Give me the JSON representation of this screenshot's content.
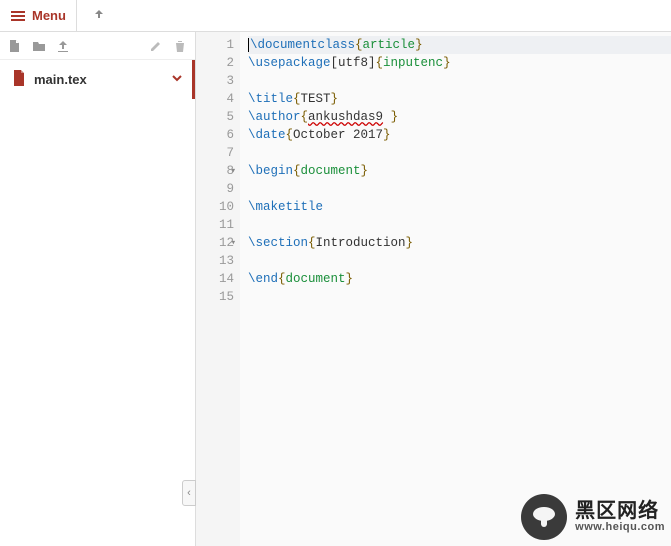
{
  "topbar": {
    "menu_label": "Menu"
  },
  "sidebar": {
    "file": {
      "name": "main.tex"
    }
  },
  "editor": {
    "lines": [
      {
        "n": 1,
        "fold": false,
        "hl": true,
        "tokens": [
          [
            "cursor",
            ""
          ],
          [
            "cmd",
            "\\documentclass"
          ],
          [
            "brace",
            "{"
          ],
          [
            "type",
            "article"
          ],
          [
            "brace",
            "}"
          ]
        ]
      },
      {
        "n": 2,
        "fold": false,
        "hl": false,
        "tokens": [
          [
            "cmd",
            "\\usepackage"
          ],
          [
            "txt",
            "[utf8]"
          ],
          [
            "brace",
            "{"
          ],
          [
            "type",
            "inputenc"
          ],
          [
            "brace",
            "}"
          ]
        ]
      },
      {
        "n": 3,
        "fold": false,
        "hl": false,
        "tokens": []
      },
      {
        "n": 4,
        "fold": false,
        "hl": false,
        "tokens": [
          [
            "cmd",
            "\\title"
          ],
          [
            "brace",
            "{"
          ],
          [
            "txt",
            "TEST"
          ],
          [
            "brace",
            "}"
          ]
        ]
      },
      {
        "n": 5,
        "fold": false,
        "hl": false,
        "tokens": [
          [
            "cmd",
            "\\author"
          ],
          [
            "brace",
            "{"
          ],
          [
            "err",
            "ankushdas9"
          ],
          [
            "txt",
            " "
          ],
          [
            "brace",
            "}"
          ]
        ]
      },
      {
        "n": 6,
        "fold": false,
        "hl": false,
        "tokens": [
          [
            "cmd",
            "\\date"
          ],
          [
            "brace",
            "{"
          ],
          [
            "txt",
            "October 2017"
          ],
          [
            "brace",
            "}"
          ]
        ]
      },
      {
        "n": 7,
        "fold": false,
        "hl": false,
        "tokens": []
      },
      {
        "n": 8,
        "fold": true,
        "hl": false,
        "tokens": [
          [
            "cmd",
            "\\begin"
          ],
          [
            "brace",
            "{"
          ],
          [
            "type",
            "document"
          ],
          [
            "brace",
            "}"
          ]
        ]
      },
      {
        "n": 9,
        "fold": false,
        "hl": false,
        "tokens": []
      },
      {
        "n": 10,
        "fold": false,
        "hl": false,
        "tokens": [
          [
            "cmd",
            "\\maketitle"
          ]
        ]
      },
      {
        "n": 11,
        "fold": false,
        "hl": false,
        "tokens": []
      },
      {
        "n": 12,
        "fold": true,
        "hl": false,
        "tokens": [
          [
            "cmd",
            "\\section"
          ],
          [
            "brace",
            "{"
          ],
          [
            "txt",
            "Introduction"
          ],
          [
            "brace",
            "}"
          ]
        ]
      },
      {
        "n": 13,
        "fold": false,
        "hl": false,
        "tokens": []
      },
      {
        "n": 14,
        "fold": false,
        "hl": false,
        "tokens": [
          [
            "cmd",
            "\\end"
          ],
          [
            "brace",
            "{"
          ],
          [
            "type",
            "document"
          ],
          [
            "brace",
            "}"
          ]
        ]
      },
      {
        "n": 15,
        "fold": false,
        "hl": false,
        "tokens": []
      }
    ]
  },
  "watermark": {
    "line1": "黑区网络",
    "line2": "www.heiqu.com"
  }
}
